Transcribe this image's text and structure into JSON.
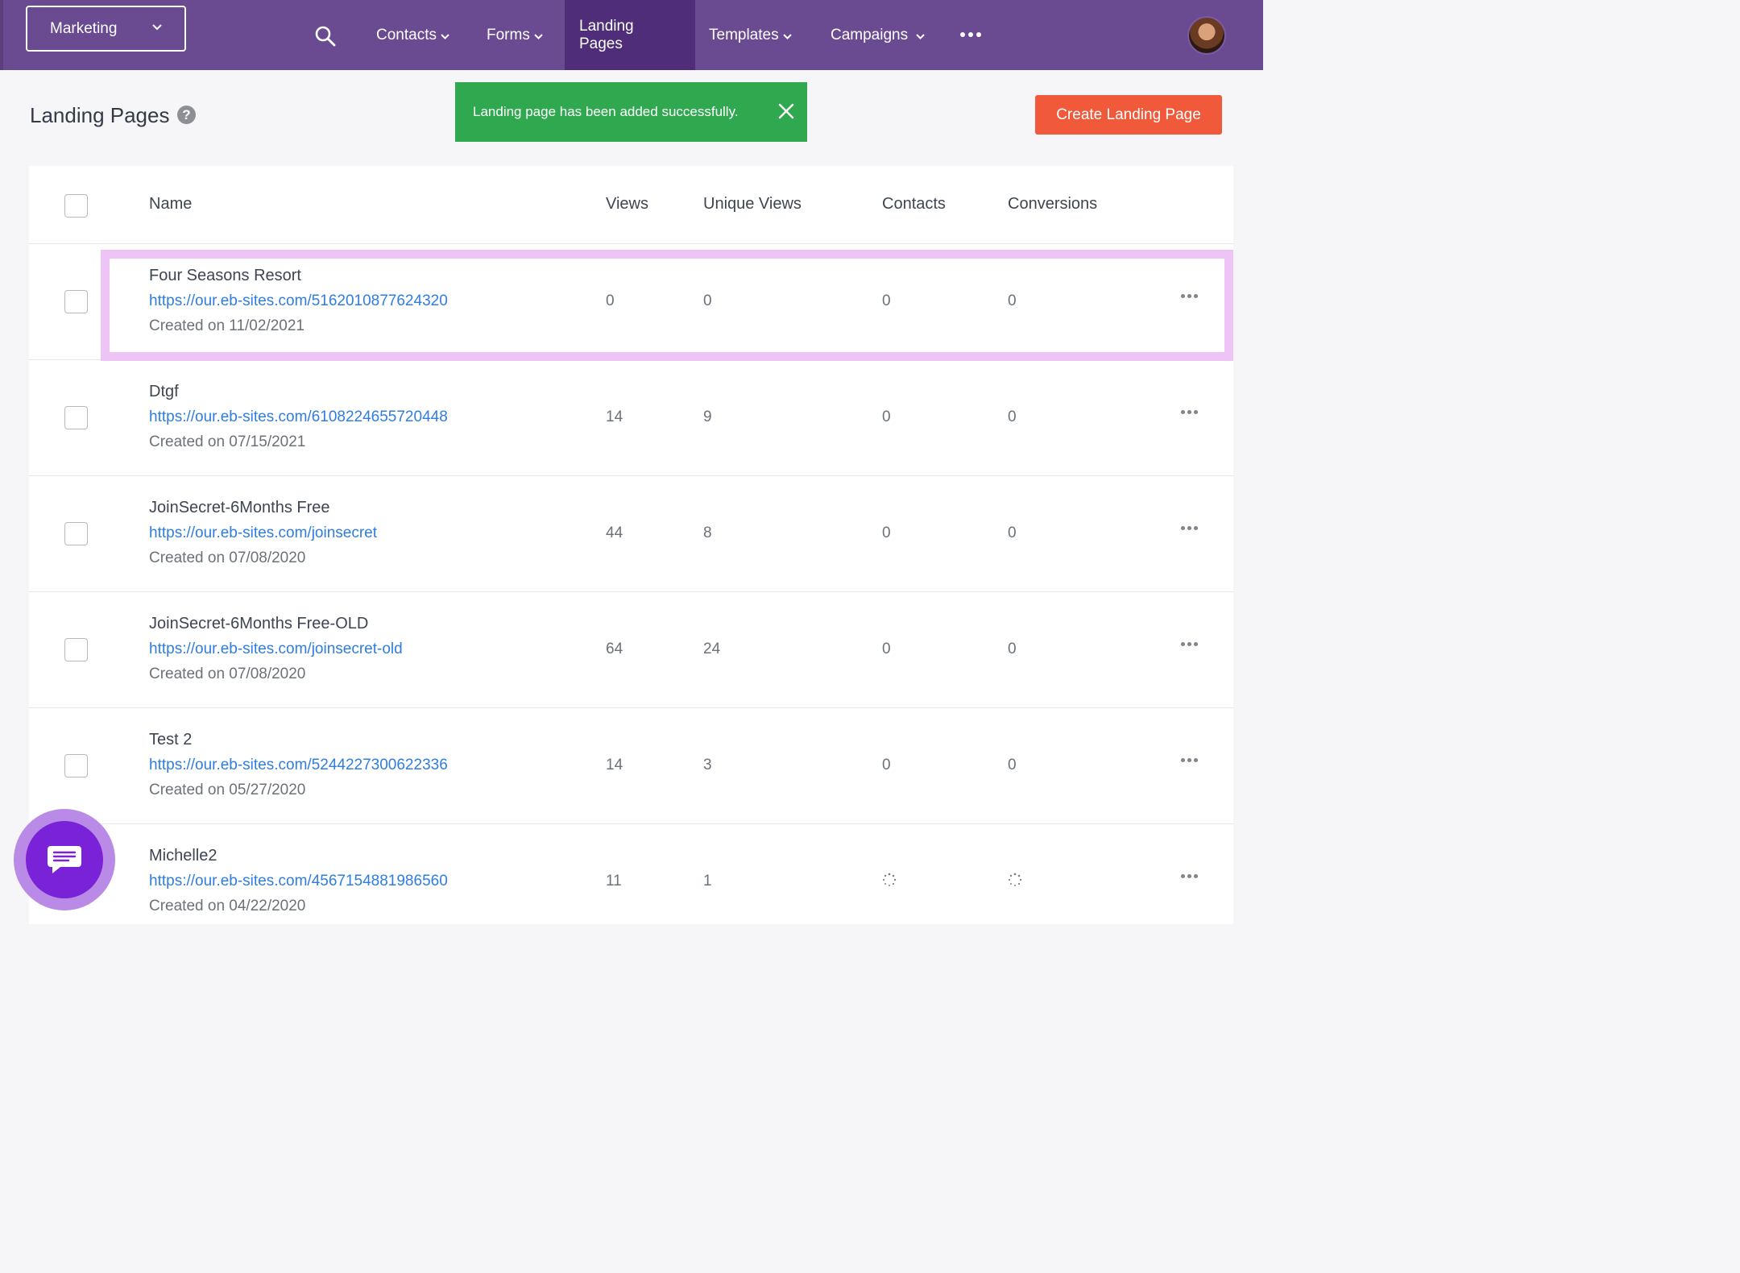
{
  "nav": {
    "workspace": "Marketing",
    "items": [
      {
        "label": "Contacts"
      },
      {
        "label": "Forms"
      },
      {
        "label": "Landing Pages"
      },
      {
        "label": "Templates"
      },
      {
        "label": "Campaigns"
      }
    ]
  },
  "header": {
    "title": "Landing Pages",
    "help": "?",
    "toast": "Landing page has been added successfully.",
    "create_label": "Create Landing Page"
  },
  "table": {
    "columns": [
      "Name",
      "Views",
      "Unique Views",
      "Contacts",
      "Conversions"
    ],
    "rows": [
      {
        "name": "Four Seasons Resort",
        "url": "https://our.eb-sites.com/5162010877624320",
        "created": "Created on 11/02/2021",
        "views": "0",
        "unique": "0",
        "contacts": "0",
        "conversions": "0"
      },
      {
        "name": "Dtgf",
        "url": "https://our.eb-sites.com/6108224655720448",
        "created": "Created on 07/15/2021",
        "views": "14",
        "unique": "9",
        "contacts": "0",
        "conversions": "0"
      },
      {
        "name": "JoinSecret-6Months Free",
        "url": "https://our.eb-sites.com/joinsecret",
        "created": "Created on 07/08/2020",
        "views": "44",
        "unique": "8",
        "contacts": "0",
        "conversions": "0"
      },
      {
        "name": "JoinSecret-6Months Free-OLD",
        "url": "https://our.eb-sites.com/joinsecret-old",
        "created": "Created on 07/08/2020",
        "views": "64",
        "unique": "24",
        "contacts": "0",
        "conversions": "0"
      },
      {
        "name": "Test 2",
        "url": "https://our.eb-sites.com/5244227300622336",
        "created": "Created on 05/27/2020",
        "views": "14",
        "unique": "3",
        "contacts": "0",
        "conversions": "0"
      },
      {
        "name": "Michelle2",
        "url": "https://our.eb-sites.com/4567154881986560",
        "created": "Created on 04/22/2020",
        "views": "11",
        "unique": "1",
        "contacts": "",
        "conversions": ""
      }
    ]
  },
  "colors": {
    "nav_bg": "#6a4a90",
    "nav_active": "#4f2d78",
    "toast": "#2fa84f",
    "create_button": "#f05a3a",
    "link": "#2f7de1",
    "highlight": "#eec4f7",
    "chat": "#7a22d8"
  },
  "icons": [
    "search-icon",
    "chevron-down-icon",
    "more-horizontal-icon",
    "help-icon",
    "close-icon",
    "loading-spinner-icon",
    "chat-icon"
  ]
}
